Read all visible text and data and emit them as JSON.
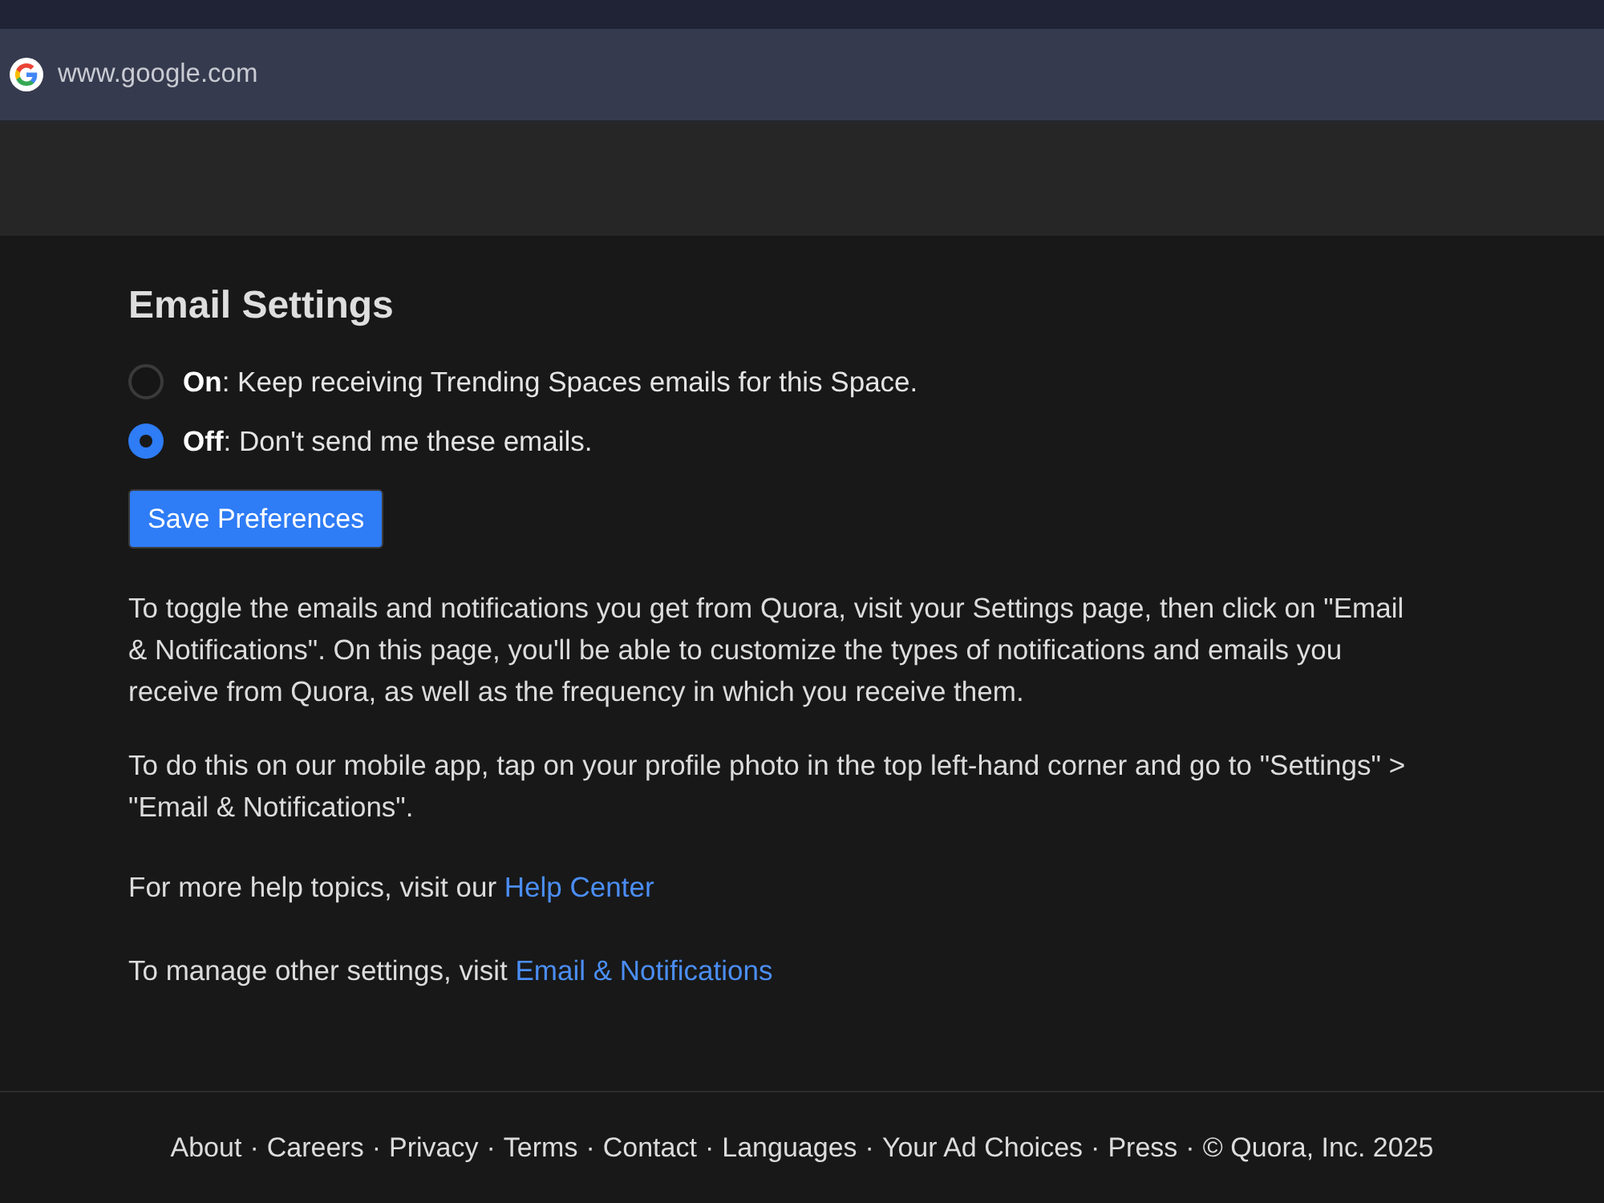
{
  "browser": {
    "address": "www.google.com"
  },
  "email_settings": {
    "title": "Email Settings",
    "options": [
      {
        "text": "**On**: Keep receiving Trending Spaces emails for this Space.",
        "selected": false
      },
      {
        "text": "**Off**: Don't send me these emails.",
        "selected": true
      }
    ],
    "save_button": "Save Preferences"
  },
  "help_paragraphs": [
    "To toggle the emails and notifications you get from Quora, visit your Settings page, then click on \"Email & Notifications\". On this page, you'll be able to customize the types of notifications and emails you receive from Quora, as well as the frequency in which you receive them.",
    "To do this on our mobile app, tap on your profile photo in the top left-hand corner and go to \"Settings\" > \"Email & Notifications\"."
  ],
  "help_links": [
    {
      "text": "For more help topics, visit our ",
      "link": "Help Center"
    },
    {
      "text": "To manage other settings, visit ",
      "link": "Email & Notifications"
    }
  ],
  "footer": {
    "links": [
      "About",
      "Careers",
      "Privacy",
      "Terms",
      "Contact",
      "Languages",
      "Your Ad Choices",
      "Press"
    ],
    "separator": "·",
    "copyright": "© Quora, Inc. 2025"
  }
}
